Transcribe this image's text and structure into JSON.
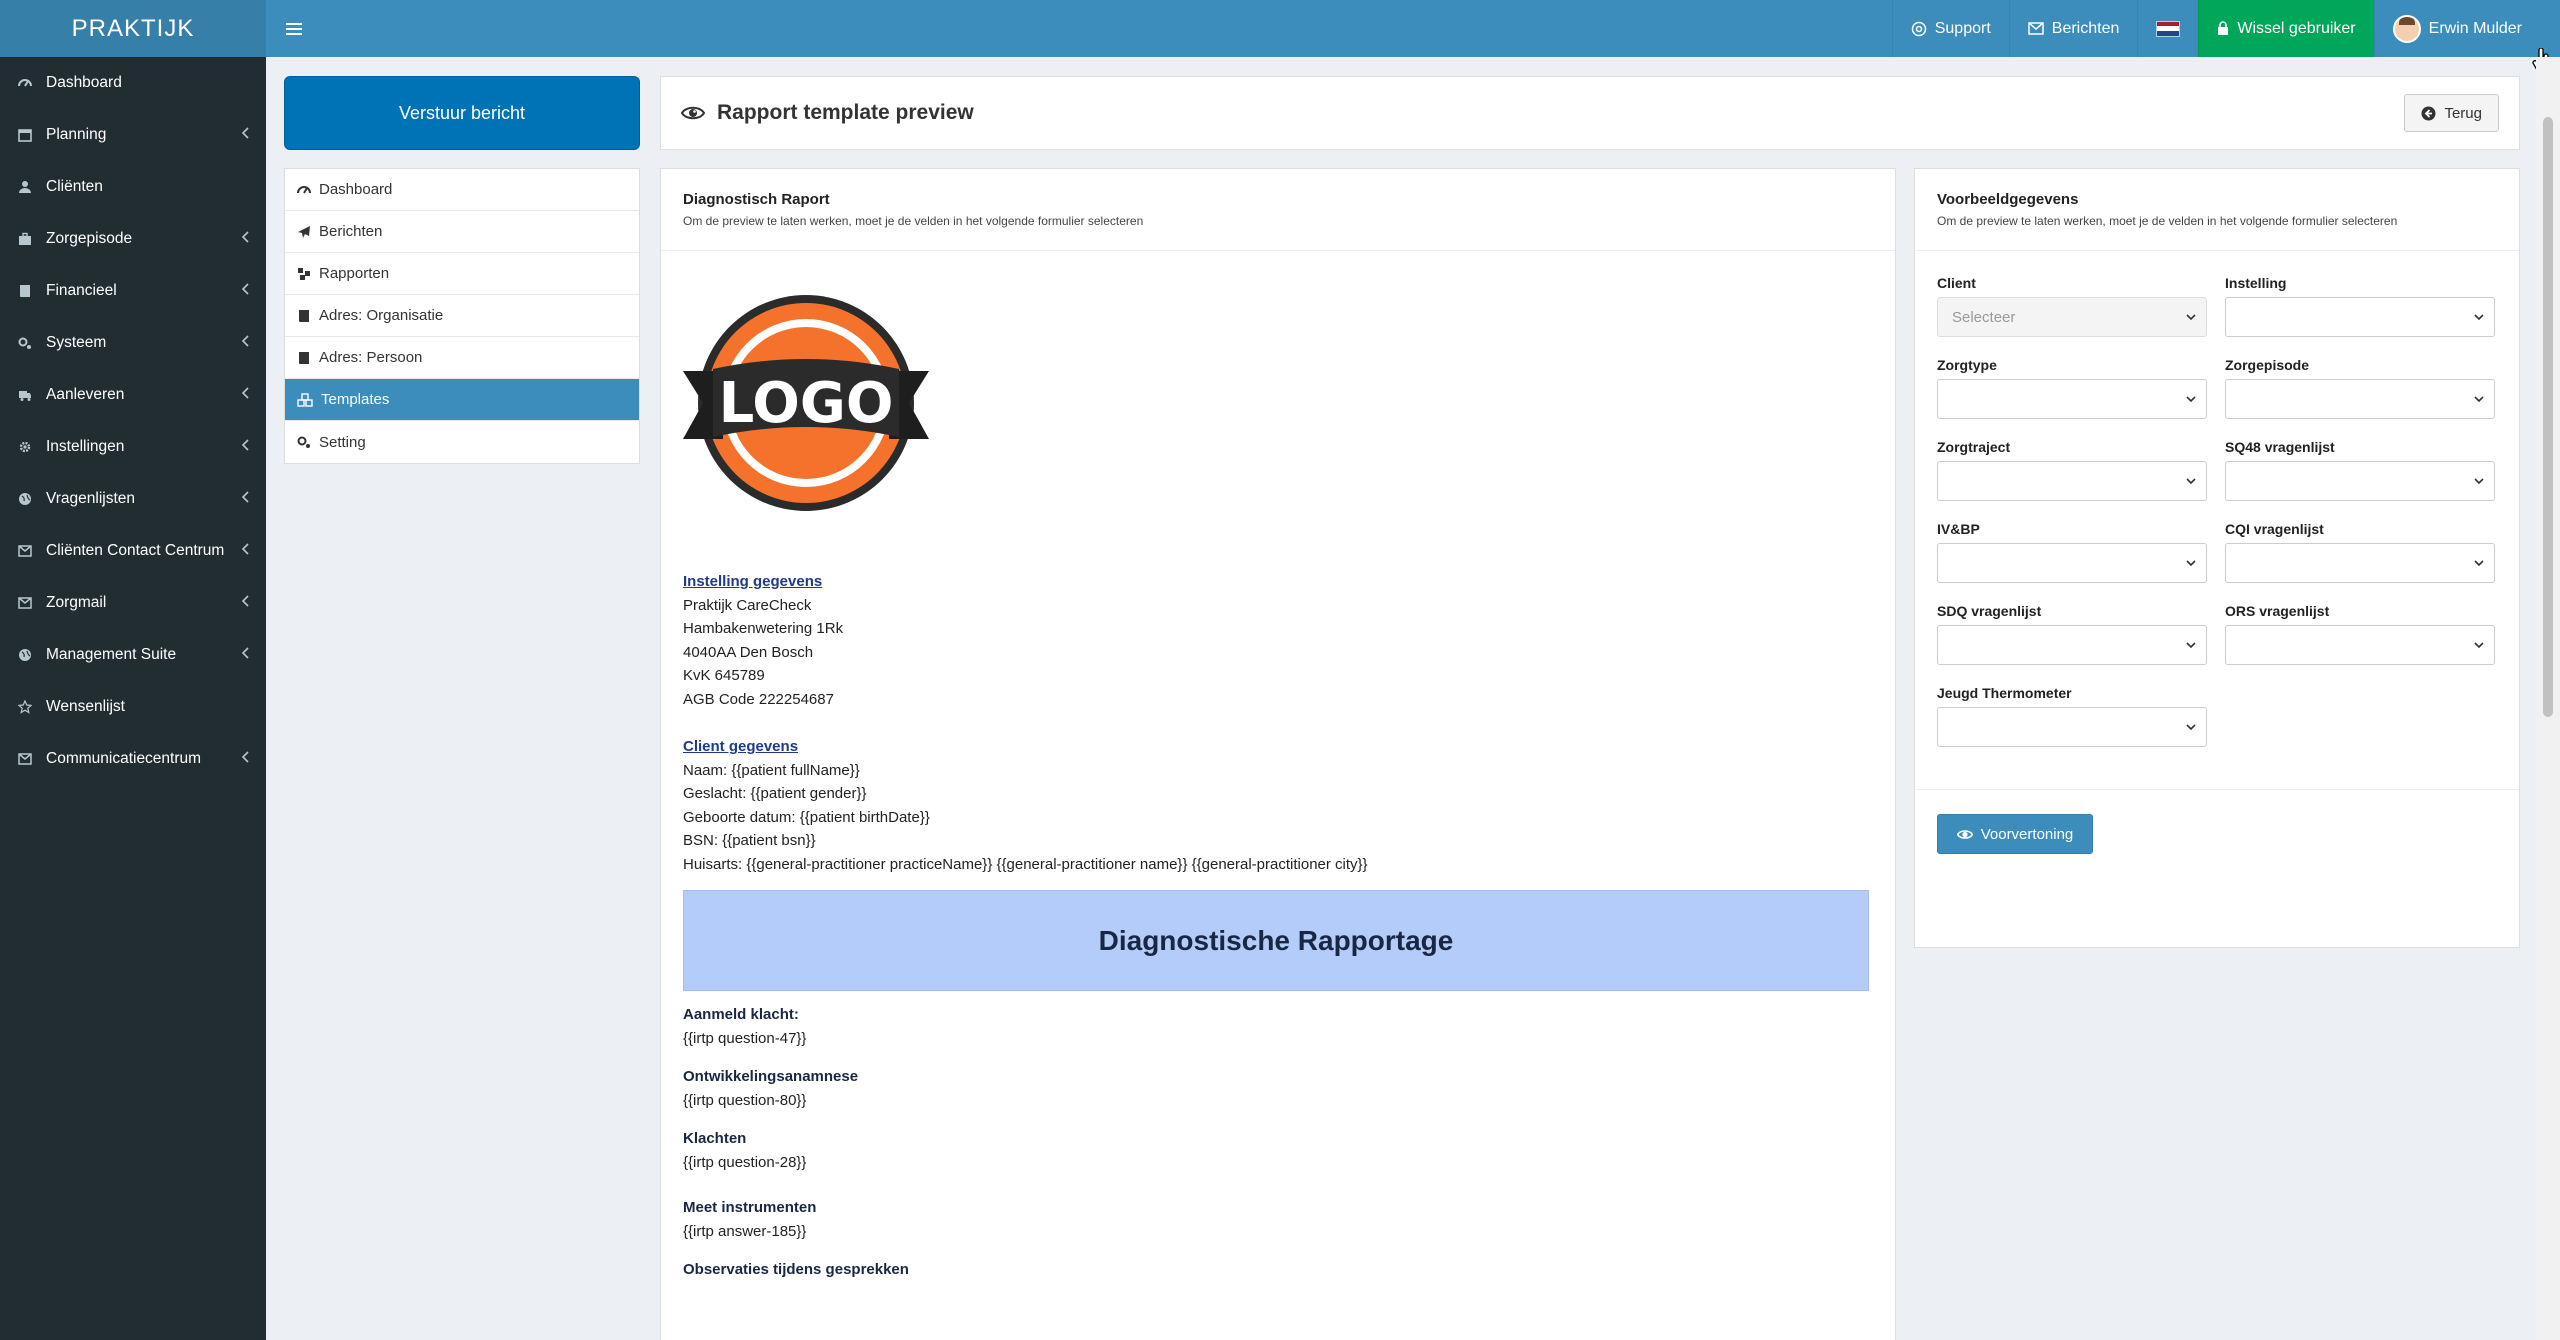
{
  "brand": "PRAKTIJK",
  "topnav": {
    "support": "Support",
    "berichten": "Berichten",
    "wissel": "Wissel gebruiker",
    "user": "Erwin Mulder"
  },
  "sidebar": {
    "items": [
      {
        "label": "Dashboard",
        "icon": "dashboard-icon",
        "chevron": false
      },
      {
        "label": "Planning",
        "icon": "calendar-icon",
        "chevron": true
      },
      {
        "label": "Cliënten",
        "icon": "user-icon",
        "chevron": false
      },
      {
        "label": "Zorgepisode",
        "icon": "briefcase-icon",
        "chevron": true
      },
      {
        "label": "Financieel",
        "icon": "book-icon",
        "chevron": true
      },
      {
        "label": "Systeem",
        "icon": "cogs-icon",
        "chevron": true
      },
      {
        "label": "Aanleveren",
        "icon": "truck-icon",
        "chevron": true
      },
      {
        "label": "Instellingen",
        "icon": "gear-icon",
        "chevron": true
      },
      {
        "label": "Vragenlijsten",
        "icon": "globe-icon",
        "chevron": true
      },
      {
        "label": "Cliënten Contact Centrum",
        "icon": "envelope-icon",
        "chevron": true
      },
      {
        "label": "Zorgmail",
        "icon": "envelope-icon",
        "chevron": true
      },
      {
        "label": "Management Suite",
        "icon": "globe-icon",
        "chevron": true
      },
      {
        "label": "Wensenlijst",
        "icon": "star-icon",
        "chevron": false
      },
      {
        "label": "Communicatiecentrum",
        "icon": "envelope-icon",
        "chevron": true
      }
    ]
  },
  "send_button": "Verstuur bericht",
  "leftmenu": {
    "items": [
      {
        "label": "Dashboard"
      },
      {
        "label": "Berichten"
      },
      {
        "label": "Rapporten"
      },
      {
        "label": "Adres: Organisatie"
      },
      {
        "label": "Adres: Persoon"
      },
      {
        "label": "Templates",
        "active": true
      },
      {
        "label": "Setting"
      }
    ]
  },
  "header": {
    "title": "Rapport template preview",
    "back": "Terug"
  },
  "report": {
    "title": "Diagnostisch Raport",
    "subtitle": "Om de preview te laten werken, moet je de velden in het volgende formulier selecteren",
    "logo_text": "LOGO",
    "instelling_title": "Instelling gegevens",
    "instelling_lines": [
      "Praktijk CareCheck",
      "Hambakenwetering 1Rk",
      "4040AA Den Bosch",
      "KvK 645789",
      "AGB Code 222254687"
    ],
    "client_title": "Client gegevens",
    "client_lines": [
      "Naam: {{patient fullName}}",
      "Geslacht: {{patient gender}}",
      "Geboorte datum: {{patient birthDate}}",
      "BSN: {{patient bsn}}",
      "Huisarts: {{general-practitioner practiceName}} {{general-practitioner name}} {{general-practitioner city}}"
    ],
    "banner": "Diagnostische Rapportage",
    "questions": [
      {
        "title": "Aanmeld klacht:",
        "value": "{{irtp question-47}}"
      },
      {
        "title": "Ontwikkelingsanamnese",
        "value": "{{irtp question-80}}"
      },
      {
        "title": "Klachten",
        "value": "{{irtp question-28}}"
      },
      {
        "title": "Meet instrumenten",
        "value": "{{irtp answer-185}}"
      },
      {
        "title": "Observaties tijdens gesprekken",
        "value": ""
      }
    ]
  },
  "sample": {
    "title": "Voorbeeldgegevens",
    "subtitle": "Om de preview te laten werken, moet je de velden in het volgende formulier selecteren",
    "fields": [
      {
        "label": "Client",
        "value": "Selecteer"
      },
      {
        "label": "Instelling",
        "value": ""
      },
      {
        "label": "Zorgtype",
        "value": ""
      },
      {
        "label": "Zorgepisode",
        "value": ""
      },
      {
        "label": "Zorgtraject",
        "value": ""
      },
      {
        "label": "SQ48 vragenlijst",
        "value": ""
      },
      {
        "label": "IV&BP",
        "value": ""
      },
      {
        "label": "CQI vragenlijst",
        "value": ""
      },
      {
        "label": "SDQ vragenlijst",
        "value": ""
      },
      {
        "label": "ORS vragenlijst",
        "value": ""
      },
      {
        "label": "Jeugd Thermometer",
        "value": ""
      }
    ],
    "preview_button": "Voorvertoning"
  },
  "colors": {
    "topbar": "#3c8dbc",
    "sidebar": "#222d32",
    "accent_green": "#00a65a",
    "banner": "#b3ccf9"
  }
}
